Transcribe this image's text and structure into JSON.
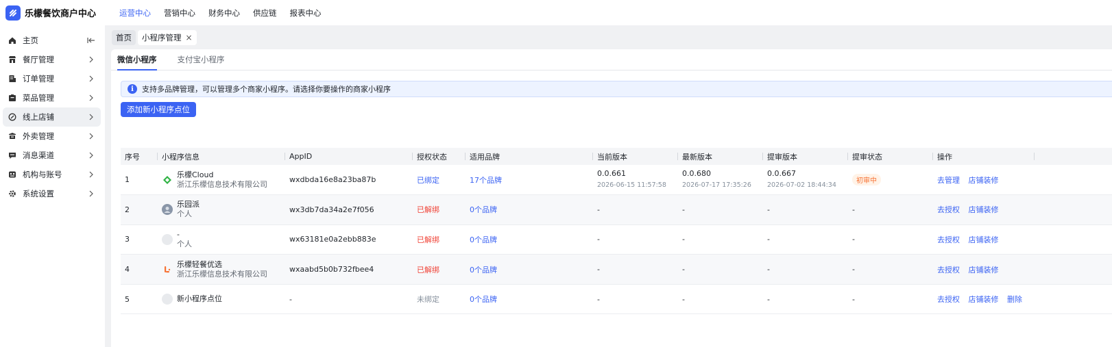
{
  "app": {
    "title": "乐檬餐饮商户中心"
  },
  "topnav": [
    {
      "label": "运营中心",
      "active": true
    },
    {
      "label": "营销中心"
    },
    {
      "label": "财务中心"
    },
    {
      "label": "供应链"
    },
    {
      "label": "报表中心"
    }
  ],
  "sidebar": {
    "items": [
      {
        "label": "主页",
        "icon": "home-icon"
      },
      {
        "label": "餐厅管理",
        "icon": "store-icon"
      },
      {
        "label": "订单管理",
        "icon": "order-icon"
      },
      {
        "label": "菜品管理",
        "icon": "dish-icon"
      },
      {
        "label": "线上店铺",
        "icon": "online-store-icon",
        "active": true
      },
      {
        "label": "外卖管理",
        "icon": "delivery-icon"
      },
      {
        "label": "消息渠道",
        "icon": "message-icon"
      },
      {
        "label": "机构与账号",
        "icon": "account-icon"
      },
      {
        "label": "系统设置",
        "icon": "gear-icon"
      }
    ]
  },
  "page_tabs": [
    {
      "label": "首页"
    },
    {
      "label": "小程序管理"
    }
  ],
  "subtabs": [
    {
      "label": "微信小程序",
      "active": true
    },
    {
      "label": "支付宝小程序"
    }
  ],
  "notice": {
    "text": "支持多品牌管理，可以管理多个商家小程序。请选择你要操作的商家小程序"
  },
  "add_button": {
    "label": "添加新小程序点位"
  },
  "table": {
    "columns": [
      "序号",
      "小程序信息",
      "AppID",
      "授权状态",
      "适用品牌",
      "当前版本",
      "最新版本",
      "提审版本",
      "提审状态",
      "操作"
    ],
    "rows": [
      {
        "index": "1",
        "name": "乐檬Cloud",
        "owner": "浙江乐檬信息技术有限公司",
        "appid": "wxdbda16e8a23ba87b",
        "auth": "已绑定",
        "brands": "17个品牌",
        "current": "0.0.661",
        "current_time": "2026-06-15 11:57:58",
        "latest": "0.0.680",
        "latest_time": "2026-07-17 17:35:26",
        "review": "0.0.667",
        "review_time": "2026-07-02 18:44:34",
        "review_status": "初审中",
        "actions": [
          "去管理",
          "店铺装修"
        ]
      },
      {
        "index": "2",
        "name": "乐园派",
        "owner": "个人",
        "appid": "wx3db7da34a2e7f056",
        "auth": "已解绑",
        "brands": "0个品牌",
        "current": "-",
        "latest": "-",
        "review": "-",
        "review_status": "-",
        "actions": [
          "去授权",
          "店铺装修"
        ]
      },
      {
        "index": "3",
        "name": "-",
        "owner": "个人",
        "appid": "wx63181e0a2ebb883e",
        "auth": "已解绑",
        "brands": "0个品牌",
        "current": "-",
        "latest": "-",
        "review": "-",
        "review_status": "-",
        "actions": [
          "去授权",
          "店铺装修"
        ]
      },
      {
        "index": "4",
        "name": "乐檬轻餐优选",
        "owner": "浙江乐檬信息技术有限公司",
        "appid": "wxaabd5b0b732fbee4",
        "auth": "已解绑",
        "brands": "0个品牌",
        "current": "-",
        "latest": "-",
        "review": "-",
        "review_status": "-",
        "actions": [
          "去授权",
          "店铺装修"
        ]
      },
      {
        "index": "5",
        "name": "新小程序点位",
        "appid": "-",
        "auth": "未绑定",
        "brands": "0个品牌",
        "current": "-",
        "latest": "-",
        "review": "-",
        "review_status": "-",
        "actions": [
          "去授权",
          "店铺装修",
          "删除"
        ]
      }
    ]
  },
  "colors": {
    "accent": "#3b63f3",
    "danger": "#f04438",
    "warning": "#f77234"
  }
}
